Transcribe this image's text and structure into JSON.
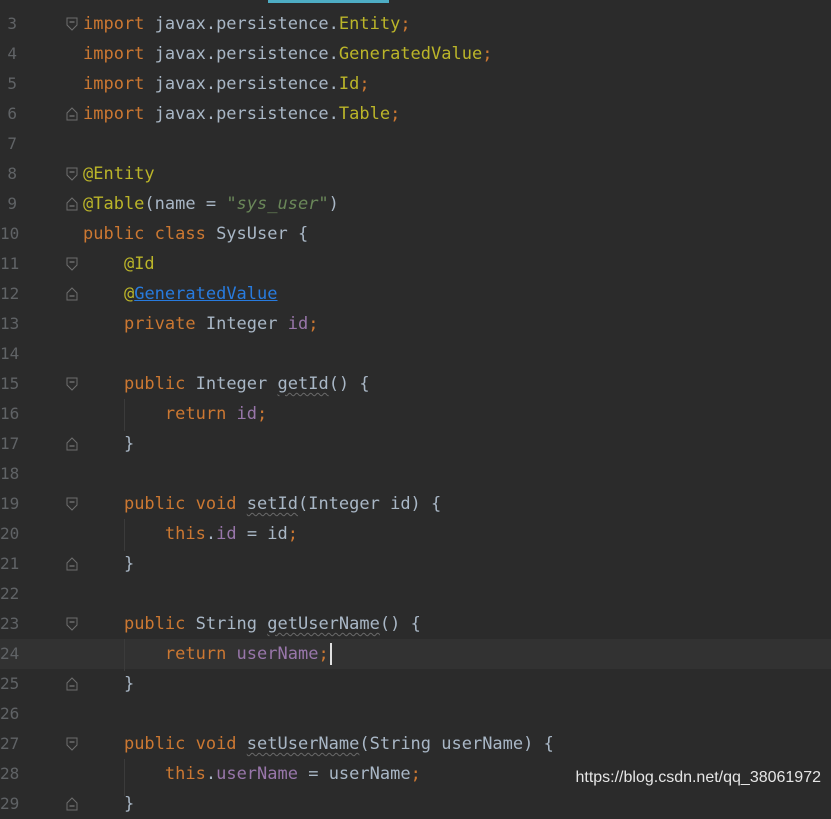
{
  "editor": {
    "lines": [
      {
        "n": "3",
        "fold": "open",
        "tokens": [
          [
            "kw",
            "import"
          ],
          [
            "pkg",
            " javax.persistence."
          ],
          [
            "cls",
            "Entity"
          ],
          [
            "sep",
            ";"
          ]
        ]
      },
      {
        "n": "4",
        "fold": "",
        "tokens": [
          [
            "kw",
            "import"
          ],
          [
            "pkg",
            " javax.persistence."
          ],
          [
            "cls",
            "GeneratedValue"
          ],
          [
            "sep",
            ";"
          ]
        ]
      },
      {
        "n": "5",
        "fold": "",
        "tokens": [
          [
            "kw",
            "import"
          ],
          [
            "pkg",
            " javax.persistence."
          ],
          [
            "cls",
            "Id"
          ],
          [
            "sep",
            ";"
          ]
        ]
      },
      {
        "n": "6",
        "fold": "close",
        "tokens": [
          [
            "kw",
            "import"
          ],
          [
            "pkg",
            " javax.persistence."
          ],
          [
            "cls",
            "Table"
          ],
          [
            "sep",
            ";"
          ]
        ]
      },
      {
        "n": "7",
        "fold": "",
        "tokens": []
      },
      {
        "n": "8",
        "fold": "open",
        "tokens": [
          [
            "ann",
            "@Entity"
          ]
        ]
      },
      {
        "n": "9",
        "fold": "close",
        "tokens": [
          [
            "ann",
            "@Table"
          ],
          [
            "pkg",
            "(name = "
          ],
          [
            "str",
            "\"sys_user\""
          ],
          [
            "pkg",
            ")"
          ]
        ]
      },
      {
        "n": "10",
        "fold": "",
        "tokens": [
          [
            "kw",
            "public class "
          ],
          [
            "pkg",
            "SysUser {"
          ]
        ]
      },
      {
        "n": "11",
        "fold": "open",
        "tokens": [
          [
            "pkg",
            "    "
          ],
          [
            "ann",
            "@Id"
          ]
        ]
      },
      {
        "n": "12",
        "fold": "close",
        "tokens": [
          [
            "pkg",
            "    "
          ],
          [
            "ann",
            "@"
          ],
          [
            "link",
            "GeneratedValue"
          ]
        ]
      },
      {
        "n": "13",
        "fold": "",
        "tokens": [
          [
            "pkg",
            "    "
          ],
          [
            "kw",
            "private "
          ],
          [
            "pkg",
            "Integer "
          ],
          [
            "fld",
            "id"
          ],
          [
            "sep",
            ";"
          ]
        ]
      },
      {
        "n": "14",
        "fold": "",
        "tokens": []
      },
      {
        "n": "15",
        "fold": "open",
        "tokens": [
          [
            "pkg",
            "    "
          ],
          [
            "kw",
            "public "
          ],
          [
            "pkg",
            "Integer "
          ],
          [
            "warn",
            "getId"
          ],
          [
            "pkg",
            "() {"
          ]
        ]
      },
      {
        "n": "16",
        "fold": "",
        "tokens": [
          [
            "pkg",
            "        "
          ],
          [
            "kw",
            "return "
          ],
          [
            "fld",
            "id"
          ],
          [
            "sep",
            ";"
          ]
        ]
      },
      {
        "n": "17",
        "fold": "close",
        "tokens": [
          [
            "pkg",
            "    }"
          ]
        ]
      },
      {
        "n": "18",
        "fold": "",
        "tokens": []
      },
      {
        "n": "19",
        "fold": "open",
        "tokens": [
          [
            "pkg",
            "    "
          ],
          [
            "kw",
            "public void "
          ],
          [
            "warn",
            "setId"
          ],
          [
            "pkg",
            "(Integer id) {"
          ]
        ]
      },
      {
        "n": "20",
        "fold": "",
        "tokens": [
          [
            "pkg",
            "        "
          ],
          [
            "kw",
            "this"
          ],
          [
            "pkg",
            "."
          ],
          [
            "fld",
            "id"
          ],
          [
            "pkg",
            " = id"
          ],
          [
            "sep",
            ";"
          ]
        ]
      },
      {
        "n": "21",
        "fold": "close",
        "tokens": [
          [
            "pkg",
            "    }"
          ]
        ]
      },
      {
        "n": "22",
        "fold": "",
        "tokens": []
      },
      {
        "n": "23",
        "fold": "open",
        "tokens": [
          [
            "pkg",
            "    "
          ],
          [
            "kw",
            "public "
          ],
          [
            "pkg",
            "String "
          ],
          [
            "warn",
            "getUserName"
          ],
          [
            "pkg",
            "() {"
          ]
        ]
      },
      {
        "n": "24",
        "fold": "",
        "current": true,
        "tokens": [
          [
            "pkg",
            "        "
          ],
          [
            "kw",
            "return "
          ],
          [
            "fld",
            "userName"
          ],
          [
            "sep",
            ";"
          ]
        ]
      },
      {
        "n": "25",
        "fold": "close",
        "tokens": [
          [
            "pkg",
            "    }"
          ]
        ]
      },
      {
        "n": "26",
        "fold": "",
        "tokens": []
      },
      {
        "n": "27",
        "fold": "open",
        "tokens": [
          [
            "pkg",
            "    "
          ],
          [
            "kw",
            "public void "
          ],
          [
            "warn",
            "setUserName"
          ],
          [
            "pkg",
            "(String userName) {"
          ]
        ]
      },
      {
        "n": "28",
        "fold": "",
        "tokens": [
          [
            "pkg",
            "        "
          ],
          [
            "kw",
            "this"
          ],
          [
            "pkg",
            "."
          ],
          [
            "fld",
            "userName"
          ],
          [
            "pkg",
            " = userName"
          ],
          [
            "sep",
            ";"
          ]
        ]
      },
      {
        "n": "29",
        "fold": "close",
        "tokens": [
          [
            "pkg",
            "    }"
          ]
        ]
      }
    ]
  },
  "watermark": "https://blog.csdn.net/qq_38061972",
  "colors": {
    "background": "#2b2b2b",
    "keyword": "#cc7832",
    "annotation": "#bbb529",
    "string": "#6a8759",
    "field": "#9876aa",
    "text": "#a9b7c6",
    "line_number": "#606366",
    "current_line": "#323232",
    "tab_accent": "#4eadc4"
  }
}
